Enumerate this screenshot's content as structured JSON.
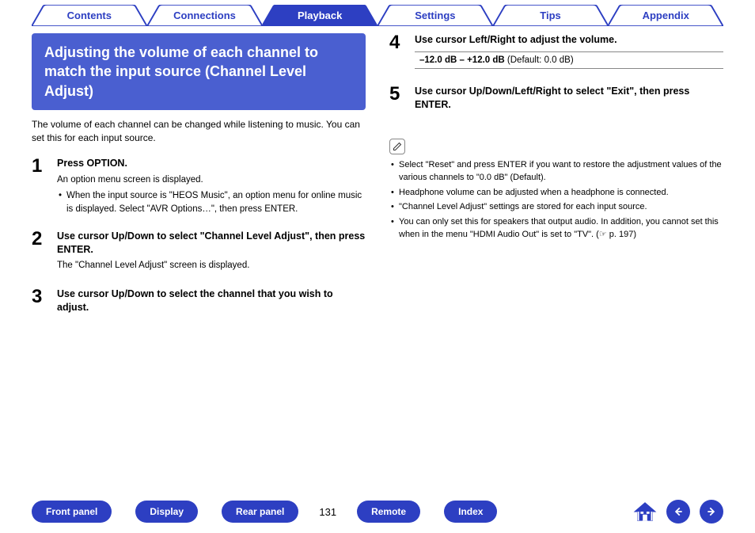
{
  "tabs": [
    {
      "label": "Contents",
      "active": false
    },
    {
      "label": "Connections",
      "active": false
    },
    {
      "label": "Playback",
      "active": true
    },
    {
      "label": "Settings",
      "active": false
    },
    {
      "label": "Tips",
      "active": false
    },
    {
      "label": "Appendix",
      "active": false
    }
  ],
  "section_title": "Adjusting the volume of each channel to match the input source (Channel Level Adjust)",
  "intro": "The volume of each channel can be changed while listening to music. You can set this for each input source.",
  "steps_left": [
    {
      "num": "1",
      "head": "Press OPTION.",
      "sub": "An option menu screen is displayed.",
      "bullets": [
        "When the input source is \"HEOS Music\", an option menu for online music is displayed. Select \"AVR Options…\", then press ENTER."
      ]
    },
    {
      "num": "2",
      "head": "Use cursor Up/Down to select \"Channel Level Adjust\", then press ENTER.",
      "sub": "The \"Channel Level Adjust\" screen is displayed.",
      "bullets": []
    },
    {
      "num": "3",
      "head": "Use cursor Up/Down to select the channel that you wish to adjust.",
      "sub": "",
      "bullets": []
    }
  ],
  "steps_right": [
    {
      "num": "4",
      "head": "Use cursor Left/Right to adjust the volume.",
      "range_bold": "–12.0 dB – +12.0 dB",
      "range_rest": " (Default: 0.0 dB)"
    },
    {
      "num": "5",
      "head": "Use cursor Up/Down/Left/Right to select \"Exit\", then press ENTER."
    }
  ],
  "notes": [
    "Select \"Reset\" and press ENTER if you want to restore the adjustment values of the various channels to \"0.0 dB\" (Default).",
    "Headphone volume can be adjusted when a headphone is connected.",
    "\"Channel Level Adjust\" settings are stored for each input source.",
    "You can only set this for speakers that output audio. In addition, you cannot set this when in the menu \"HDMI Audio Out\" is set to \"TV\".  (☞ p. 197)"
  ],
  "bottom": {
    "front": "Front panel",
    "display": "Display",
    "rear": "Rear panel",
    "page": "131",
    "remote": "Remote",
    "index": "Index"
  }
}
